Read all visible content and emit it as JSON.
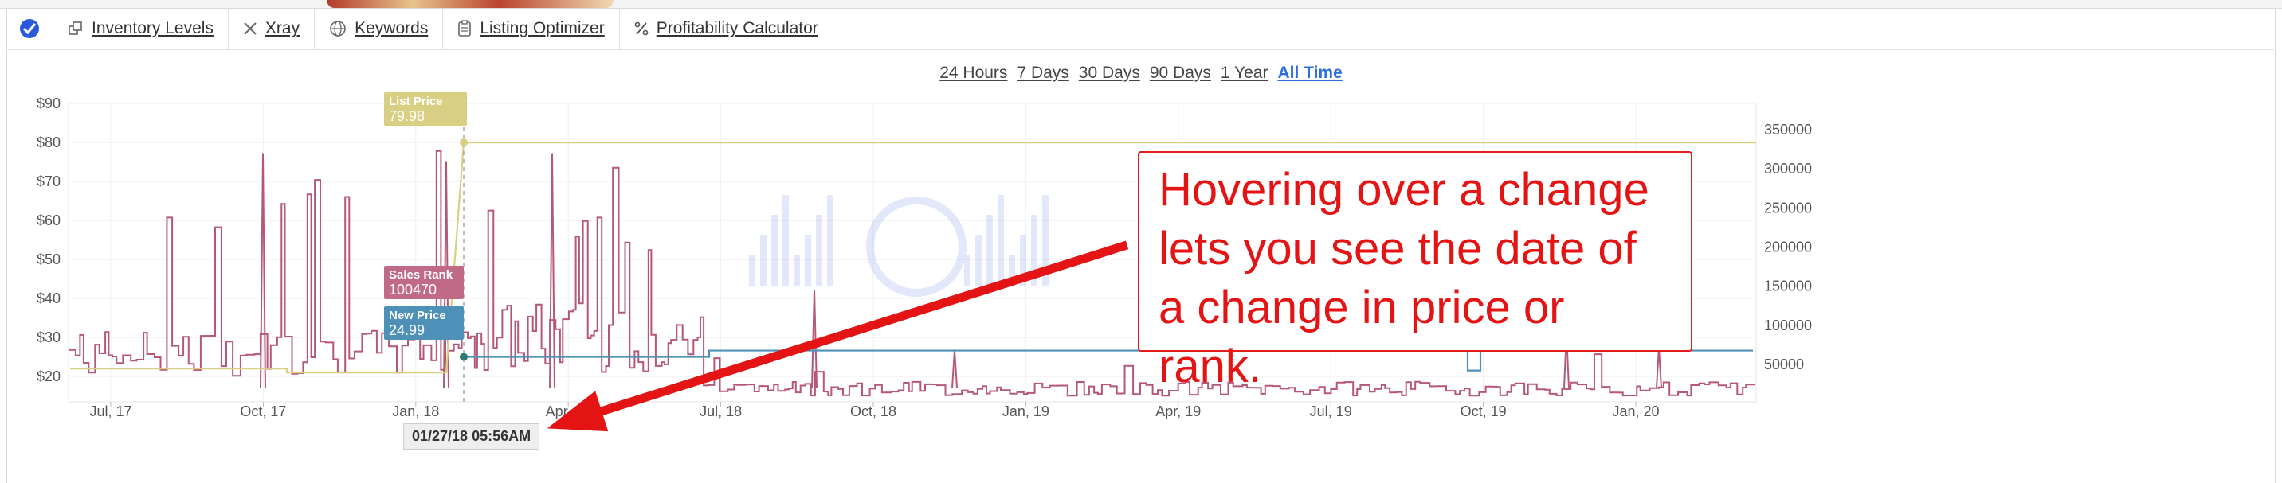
{
  "toolbar": {
    "items": [
      {
        "label": "Inventory Levels",
        "icon": "copy-icon"
      },
      {
        "label": "Xray",
        "icon": "close-icon"
      },
      {
        "label": "Keywords",
        "icon": "globe-icon"
      },
      {
        "label": "Listing Optimizer",
        "icon": "clipboard-icon"
      },
      {
        "label": "Profitability Calculator",
        "icon": "percent-icon"
      }
    ]
  },
  "ranges": [
    "24 Hours",
    "7 Days",
    "30 Days",
    "90 Days",
    "1 Year",
    "All Time"
  ],
  "active_range": "All Time",
  "chart_data": {
    "type": "line",
    "x_ticks": [
      "Jul, 17",
      "Oct, 17",
      "Jan, 18",
      "Apr, 18",
      "Jul, 18",
      "Oct, 18",
      "Jan, 19",
      "Apr, 19",
      "Jul, 19",
      "Oct, 19",
      "Jan, 20"
    ],
    "y_left_ticks": [
      "$20",
      "$30",
      "$40",
      "$50",
      "$60",
      "$70",
      "$80",
      "$90"
    ],
    "y_right_ticks": [
      "50000",
      "100000",
      "150000",
      "200000",
      "250000",
      "300000",
      "350000"
    ],
    "series": [
      {
        "name": "List Price",
        "color": "#d8cf82",
        "axis": "left",
        "y": 79.98
      },
      {
        "name": "Sales Rank",
        "color": "#b5577a",
        "axis": "right"
      },
      {
        "name": "New Price",
        "color": "#4d90b8",
        "axis": "left",
        "y": 24.99
      }
    ]
  },
  "tooltips": {
    "list_price": {
      "label": "List Price",
      "value": "79.98"
    },
    "sales_rank": {
      "label": "Sales Rank",
      "value": "100470"
    },
    "new_price": {
      "label": "New Price",
      "value": "24.99"
    },
    "date": "01/27/18 05:56AM"
  },
  "callout": {
    "text": "Hovering over a change lets you see the date of a change in price or rank."
  }
}
